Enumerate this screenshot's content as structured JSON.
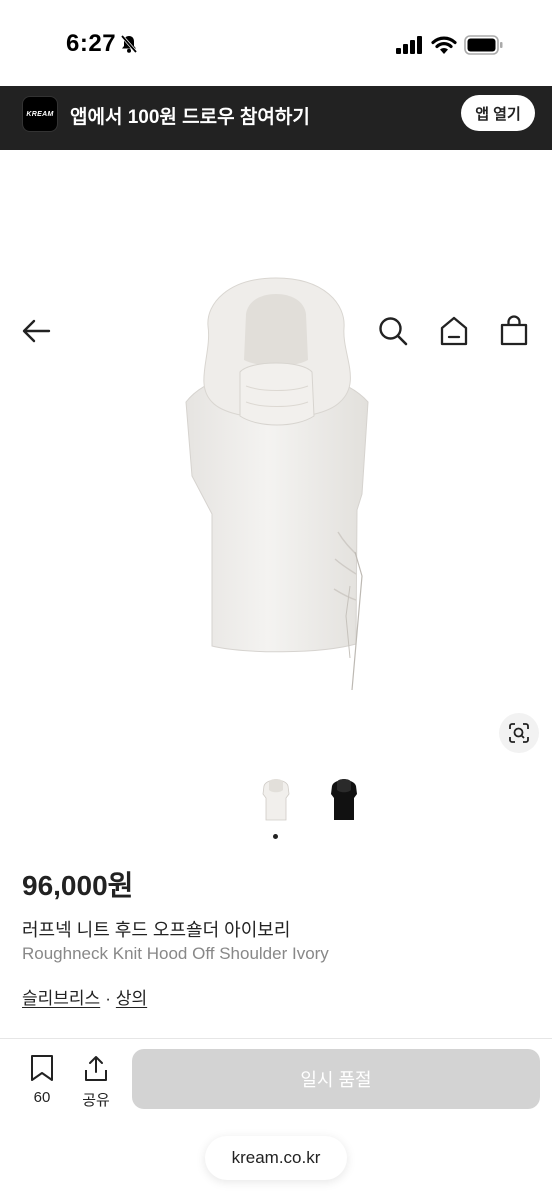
{
  "status_bar": {
    "time": "6:27"
  },
  "banner": {
    "logo_text": "KREAM",
    "text": "앱에서 100원 드로우 참여하기",
    "button_label": "앱 열기"
  },
  "nav": {
    "back_icon": "arrow-left-icon",
    "search_icon": "search-icon",
    "home_icon": "home-icon",
    "cart_icon": "shopping-bag-icon"
  },
  "product": {
    "price": "96,000원",
    "name_ko": "러프넥 니트 후드 오프숄더 아이보리",
    "name_en": "Roughneck Knit Hood Off Shoulder Ivory",
    "brand": "슬리브리스",
    "separator": "·",
    "category": "상의",
    "thumbnails": [
      {
        "color": "#f1efec",
        "label": "ivory"
      },
      {
        "color": "#111111",
        "label": "black"
      }
    ]
  },
  "bottom_bar": {
    "bookmark_count": "60",
    "share_label": "공유",
    "buy_button": "일시 품절"
  },
  "browser": {
    "url": "kream.co.kr"
  }
}
